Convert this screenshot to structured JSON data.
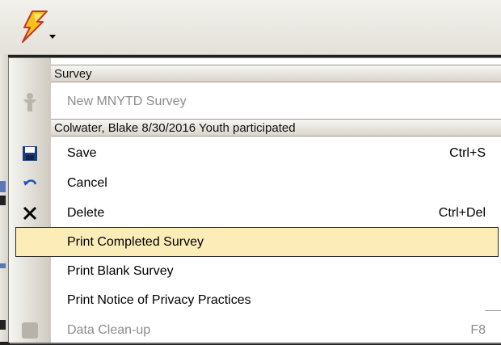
{
  "toolbar": {
    "app_button_icon": "lightning-bolt-icon",
    "dropdown_icon": "caret-down-icon"
  },
  "menu": {
    "survey_header": "Survey",
    "new_survey": {
      "label": "New MNYTD Survey",
      "icon": "person-figure-icon",
      "enabled": false
    },
    "record_header": "Colwater, Blake 8/30/2016 Youth participated",
    "items": [
      {
        "label": "Save",
        "shortcut": "Ctrl+S",
        "icon": "floppy-disk-icon"
      },
      {
        "label": "Cancel",
        "shortcut": "",
        "icon": "undo-arrow-icon"
      },
      {
        "label": "Delete",
        "shortcut": "Ctrl+Del",
        "icon": "x-icon"
      },
      {
        "label": "Print Completed Survey",
        "shortcut": "",
        "icon": "",
        "highlighted": true
      },
      {
        "label": "Print Blank Survey",
        "shortcut": "",
        "icon": ""
      },
      {
        "label": "Print Notice of Privacy Practices",
        "shortcut": "",
        "icon": ""
      },
      {
        "label": "Data Clean-up",
        "shortcut": "F8",
        "icon": "gray-square-icon",
        "enabled": false
      }
    ]
  },
  "colors": {
    "highlight_bg": "#fbecb8",
    "header_bg": "#e6e3db",
    "disabled_text": "#8c8c8c"
  }
}
